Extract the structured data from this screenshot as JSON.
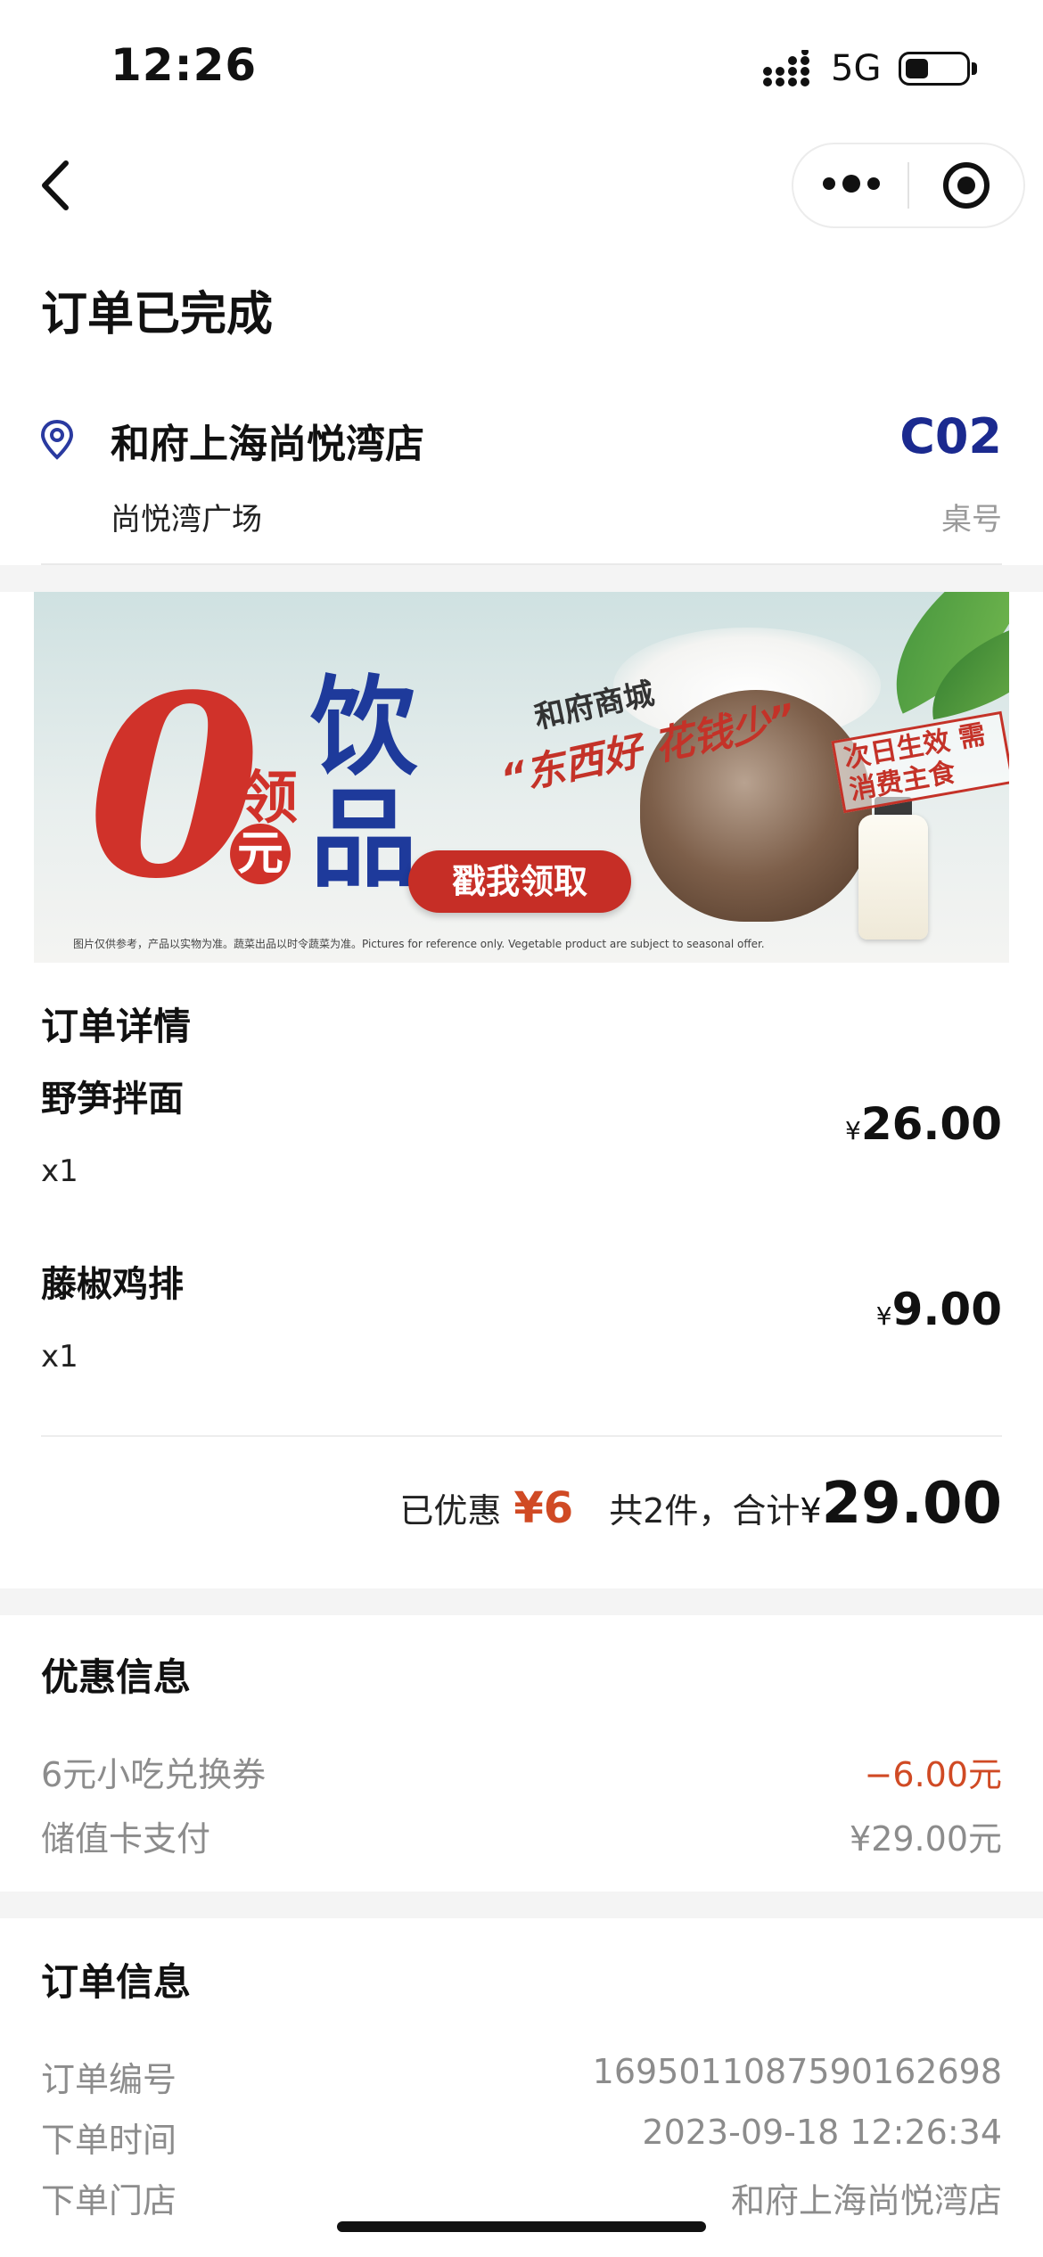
{
  "status_bar": {
    "time": "12:26",
    "network": "5G"
  },
  "page": {
    "title": "订单已完成"
  },
  "store": {
    "name": "和府上海尚悦湾店",
    "address": "尚悦湾广场",
    "table_code": "C02",
    "table_label": "桌号"
  },
  "banner": {
    "zero": "0",
    "ling": "领",
    "yuan": "元",
    "drink": "饮品",
    "mall": "和府商城",
    "slogan": "“东西好 花钱少”",
    "cta": "戳我领取",
    "tag": "次日生效 需消费主食",
    "note": "图片仅供参考，产品以实物为准。蔬菜出品以时令蔬菜为准。Pictures for reference only. Vegetable product are subject to seasonal offer."
  },
  "order_details": {
    "title": "订单详情",
    "currency": "¥",
    "items": [
      {
        "name": "野笋拌面",
        "qty": "x1",
        "price": "26.00"
      },
      {
        "name": "藤椒鸡排",
        "qty": "x1",
        "price": "9.00"
      }
    ],
    "discount_label": "已优惠",
    "discount_value": "¥6",
    "count_label": "共2件，合计",
    "total": "29.00"
  },
  "discount_info": {
    "title": "优惠信息",
    "rows": [
      {
        "label": "6元小吃兑换券",
        "value": "−6.00元"
      },
      {
        "label": "储值卡支付",
        "value": "¥29.00元"
      }
    ]
  },
  "order_info": {
    "title": "订单信息",
    "rows": [
      {
        "label": "订单编号",
        "value": "1695011087590162698"
      },
      {
        "label": "下单时间",
        "value": "2023-09-18 12:26:34"
      },
      {
        "label": "下单门店",
        "value": "和府上海尚悦湾店"
      }
    ]
  },
  "colors": {
    "accent_blue": "#1b2a8f",
    "discount_red": "#d04a24",
    "banner_red": "#d0322a",
    "banner_blue": "#1e3a9b"
  }
}
